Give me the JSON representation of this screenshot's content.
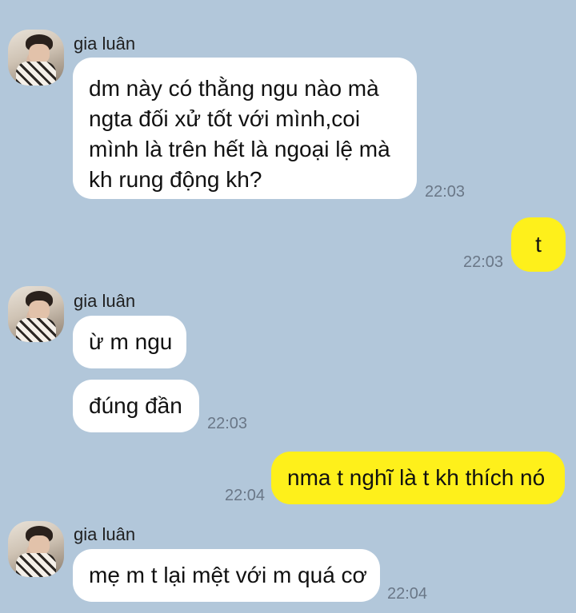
{
  "messages": [
    {
      "sender": "gia luân",
      "text_lines": [
        "dm này có thằng ngu nào mà",
        "ngta đối xử tốt với mình,coi",
        "mình là trên hết là ngoại lệ mà",
        "kh rung động kh?"
      ],
      "time": "22:03"
    },
    {
      "text": "t",
      "time": "22:03"
    },
    {
      "sender": "gia luân",
      "text": "ừ m ngu"
    },
    {
      "text": "đúng đần",
      "time": "22:03"
    },
    {
      "text": "nma t nghĩ là t kh thích nó",
      "time": "22:04"
    },
    {
      "sender": "gia luân",
      "text": "mẹ m t lại mệt với m quá cơ",
      "time": "22:04"
    }
  ]
}
